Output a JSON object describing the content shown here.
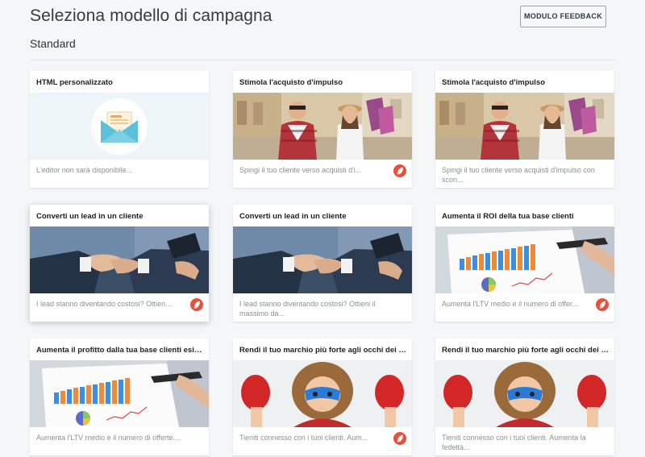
{
  "header": {
    "title": "Seleziona modello di campagna",
    "feedback_button": "MODULO FEEDBACK"
  },
  "section": {
    "title": "Standard"
  },
  "cards": [
    {
      "title": "HTML personalizzato",
      "image": "envelope-icon",
      "description": "L'editor non sarà disponibile...",
      "badge": false
    },
    {
      "title": "Stimola l'acquisto d'impulso",
      "image": "shopping-couple-photo",
      "description": "Spingi il tuo cliente verso acquisti d'i...",
      "badge": true
    },
    {
      "title": "Stimola l'acquisto d'impulso",
      "image": "shopping-couple-photo",
      "description": "Spingi il tuo cliente verso acquisti d'impulso con scon...",
      "badge": false
    },
    {
      "title": "Converti un lead in un cliente",
      "image": "handshake-photo",
      "description": "I lead stanno diventando costosi? Ottien...",
      "badge": true
    },
    {
      "title": "Converti un lead in un cliente",
      "image": "handshake-photo",
      "description": "I lead stanno diventando costosi? Ottieni il massimo da...",
      "badge": false
    },
    {
      "title": "Aumenta il ROI della tua base clienti",
      "image": "business-chart-photo",
      "description": "Aumenta l'LTV medio e il numero di offer...",
      "badge": true
    },
    {
      "title": "Aumenta il profitto dalla tua base clienti esistente",
      "image": "business-chart-photo",
      "description": "Aumenta l'LTV medio e il numero di offerte....",
      "badge": false
    },
    {
      "title": "Rendi il tuo marchio più forte agli occhi dei tuoi c...",
      "image": "superhero-kid-photo",
      "description": "Tieniti connesso con i tuoi clienti. Aum...",
      "badge": true
    },
    {
      "title": "Rendi il tuo marchio più forte agli occhi dei tuoi c...",
      "image": "superhero-kid-photo",
      "description": "Tieniti connesso con i tuoi clienti. Aumenta la fedeltà...",
      "badge": false
    }
  ],
  "colors": {
    "badge": "#e8503c",
    "envelope": "#5bc0d8",
    "background": "#f4f6f8"
  }
}
